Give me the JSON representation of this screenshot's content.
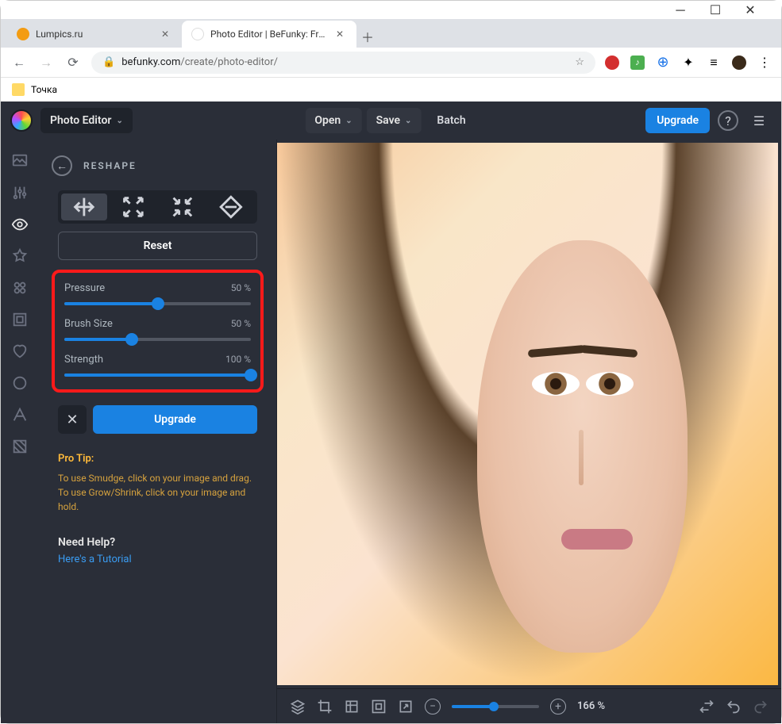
{
  "window": {
    "title": "Photo Editor | BeFunky: Free Onl"
  },
  "tabs": [
    {
      "title": "Lumpics.ru",
      "fav_color": "#f39c12",
      "active": false
    },
    {
      "title": "Photo Editor | BeFunky: Free Onl",
      "fav_color": "#ffffff",
      "active": true
    }
  ],
  "url": {
    "host": "befunky.com",
    "path": "/create/photo-editor/"
  },
  "bookmarks": {
    "item1": "Точка"
  },
  "appbar": {
    "editor_label": "Photo Editor",
    "open": "Open",
    "save": "Save",
    "batch": "Batch",
    "upgrade": "Upgrade"
  },
  "panel": {
    "title": "RESHAPE",
    "reset": "Reset",
    "sliders": {
      "pressure": {
        "label": "Pressure",
        "value": "50 %",
        "pct": 50
      },
      "brush": {
        "label": "Brush Size",
        "value": "50 %",
        "pct": 36
      },
      "strength": {
        "label": "Strength",
        "value": "100 %",
        "pct": 100
      }
    },
    "upgrade": "Upgrade",
    "tip_h": "Pro Tip:",
    "tip_b": "To use Smudge, click on your image and drag. To use Grow/Shrink, click on your image and hold.",
    "help_h": "Need Help?",
    "help_l": "Here's a Tutorial"
  },
  "bottom": {
    "zoom": "166 %"
  }
}
